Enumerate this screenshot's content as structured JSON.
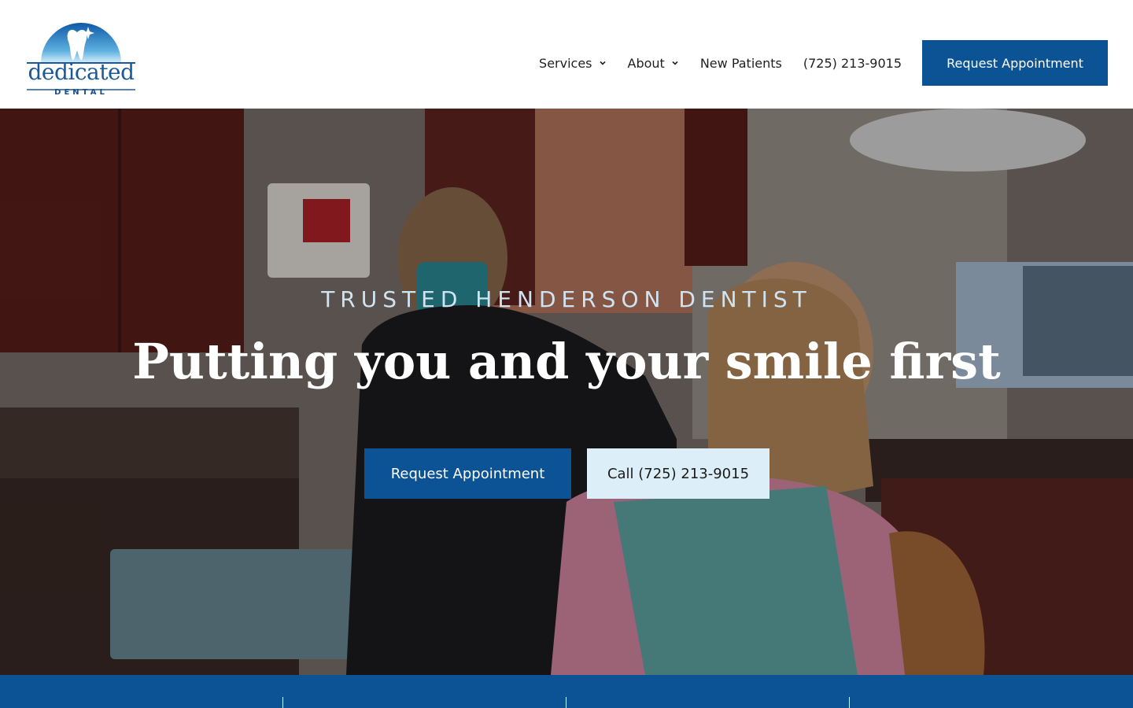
{
  "brand": {
    "name": "dedicated",
    "tagline": "DENTAL",
    "colors": {
      "primary": "#0b5394",
      "light": "#dceff8",
      "logo_blue": "#1a5a9c"
    }
  },
  "nav": {
    "items": [
      {
        "label": "Services",
        "has_dropdown": true,
        "icon": "chevron-down-icon"
      },
      {
        "label": "About",
        "has_dropdown": true,
        "icon": "chevron-down-icon"
      },
      {
        "label": "New Patients",
        "has_dropdown": false
      },
      {
        "label": "(725) 213-9015",
        "has_dropdown": false
      }
    ],
    "cta_label": "Request Appointment"
  },
  "hero": {
    "eyebrow": "TRUSTED HENDERSON DENTIST",
    "title": "Putting you and your smile first",
    "primary_button": "Request Appointment",
    "secondary_button": "Call (725) 213-9015"
  }
}
